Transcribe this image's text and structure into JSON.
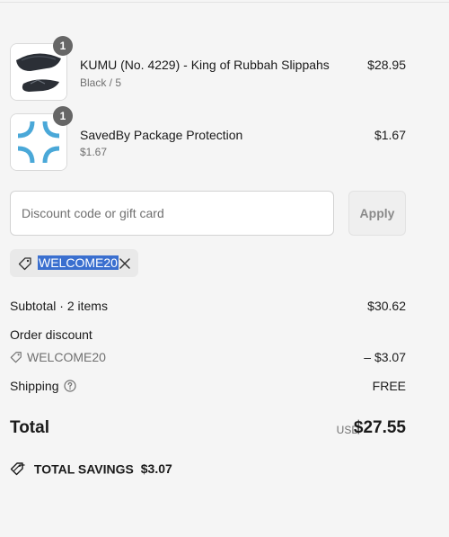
{
  "line_items": [
    {
      "title": "KUMU (No. 4229) - King of Rubbah Slippahs",
      "subtitle": "Black / 5",
      "price": "$28.95",
      "quantity": "1"
    },
    {
      "title": "SavedBy Package Protection",
      "subtitle": "$1.67",
      "price": "$1.67",
      "quantity": "1"
    }
  ],
  "discount": {
    "placeholder": "Discount code or gift card",
    "apply_label": "Apply",
    "applied_code": "WELCOME20"
  },
  "summary": {
    "subtotal_label": "Subtotal · 2 items",
    "subtotal_value": "$30.62",
    "order_discount_label": "Order discount",
    "order_discount_code": "WELCOME20",
    "order_discount_value": "– $3.07",
    "shipping_label": "Shipping",
    "shipping_value": "FREE",
    "total_label": "Total",
    "currency": "USD",
    "total_value": "$27.55",
    "savings_label": "TOTAL SAVINGS",
    "savings_value": "$3.07"
  },
  "colors": {
    "highlight": "#3a6fcf",
    "protection_icon": "#4aa8d8",
    "badge": "#666666"
  }
}
